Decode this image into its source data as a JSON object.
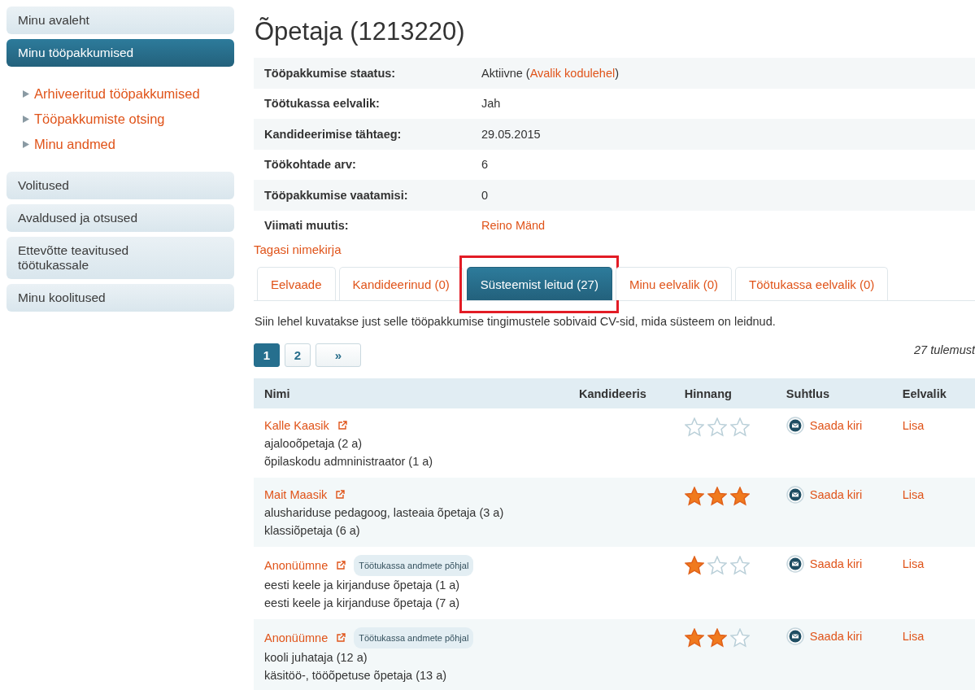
{
  "sidebar": {
    "items": [
      {
        "label": "Minu avaleht",
        "selected": false
      },
      {
        "label": "Minu tööpakkumised",
        "selected": true,
        "children": [
          {
            "label": "Arhiveeritud tööpakkumised"
          },
          {
            "label": "Tööpakkumiste otsing"
          },
          {
            "label": "Minu andmed"
          }
        ]
      },
      {
        "label": "Volitused",
        "selected": false
      },
      {
        "label": "Avaldused ja otsused",
        "selected": false
      },
      {
        "label": "Ettevõtte teavitused töötukassale",
        "selected": false
      },
      {
        "label": "Minu koolitused",
        "selected": false
      }
    ]
  },
  "title": "Õpetaja (1213220)",
  "details": [
    {
      "label": "Tööpakkumise staatus:",
      "value": "Aktiivne (",
      "link": "Avalik kodulehel",
      "suffix": ")"
    },
    {
      "label": "Töötukassa eelvalik:",
      "value": "Jah"
    },
    {
      "label": "Kandideerimise tähtaeg:",
      "value": "29.05.2015"
    },
    {
      "label": "Töökohtade arv:",
      "value": "6"
    },
    {
      "label": "Tööpakkumise vaatamisi:",
      "value": "0"
    },
    {
      "label": "Viimati muutis:",
      "link": "Reino Mänd"
    }
  ],
  "back_link": "Tagasi nimekirja",
  "tabs": [
    {
      "label": "Eelvaade",
      "selected": false,
      "highlighted": false
    },
    {
      "label": "Kandideerinud (0)",
      "selected": false,
      "highlighted": false
    },
    {
      "label": "Süsteemist leitud (27)",
      "selected": true,
      "highlighted": true
    },
    {
      "label": "Minu eelvalik (0)",
      "selected": false,
      "highlighted": false
    },
    {
      "label": "Töötukassa eelvalik (0)",
      "selected": false,
      "highlighted": false
    }
  ],
  "description": "Siin lehel kuvatakse just selle tööpakkumise tingimustele sobivaid CV-sid, mida süsteem on leidnud.",
  "pagination": {
    "pages": [
      {
        "label": "1",
        "selected": true
      },
      {
        "label": "2",
        "selected": false
      }
    ],
    "next": "»"
  },
  "result_count": "27 tulemust",
  "table": {
    "columns": [
      "Nimi",
      "Kandideeris",
      "Hinnang",
      "Suhtlus",
      "Eelvalik"
    ],
    "rows": [
      {
        "name": "Kalle Kaasik",
        "badge": null,
        "jobs": [
          "ajalooõpetaja (2 a)",
          "õpilaskodu admninistraator (1 a)"
        ],
        "stars": 0,
        "contact": "Saada kiri",
        "action": "Lisa"
      },
      {
        "name": "Mait Maasik",
        "badge": null,
        "jobs": [
          "alushariduse pedagoog, lasteaia õpetaja (3 a)",
          "klassiõpetaja (6 a)"
        ],
        "stars": 3,
        "contact": "Saada kiri",
        "action": "Lisa"
      },
      {
        "name": "Anonüümne",
        "badge": "Töötukassa andmete põhjal",
        "jobs": [
          "eesti keele ja kirjanduse õpetaja (1 a)",
          "eesti keele ja kirjanduse õpetaja (7 a)"
        ],
        "stars": 1,
        "contact": "Saada kiri",
        "action": "Lisa"
      },
      {
        "name": "Anonüümne",
        "badge": "Töötukassa andmete põhjal",
        "jobs": [
          "kooli juhataja (12 a)",
          "käsitöö-, tööõpetuse õpetaja (13 a)"
        ],
        "stars": 2,
        "contact": "Saada kiri",
        "action": "Lisa"
      }
    ]
  }
}
